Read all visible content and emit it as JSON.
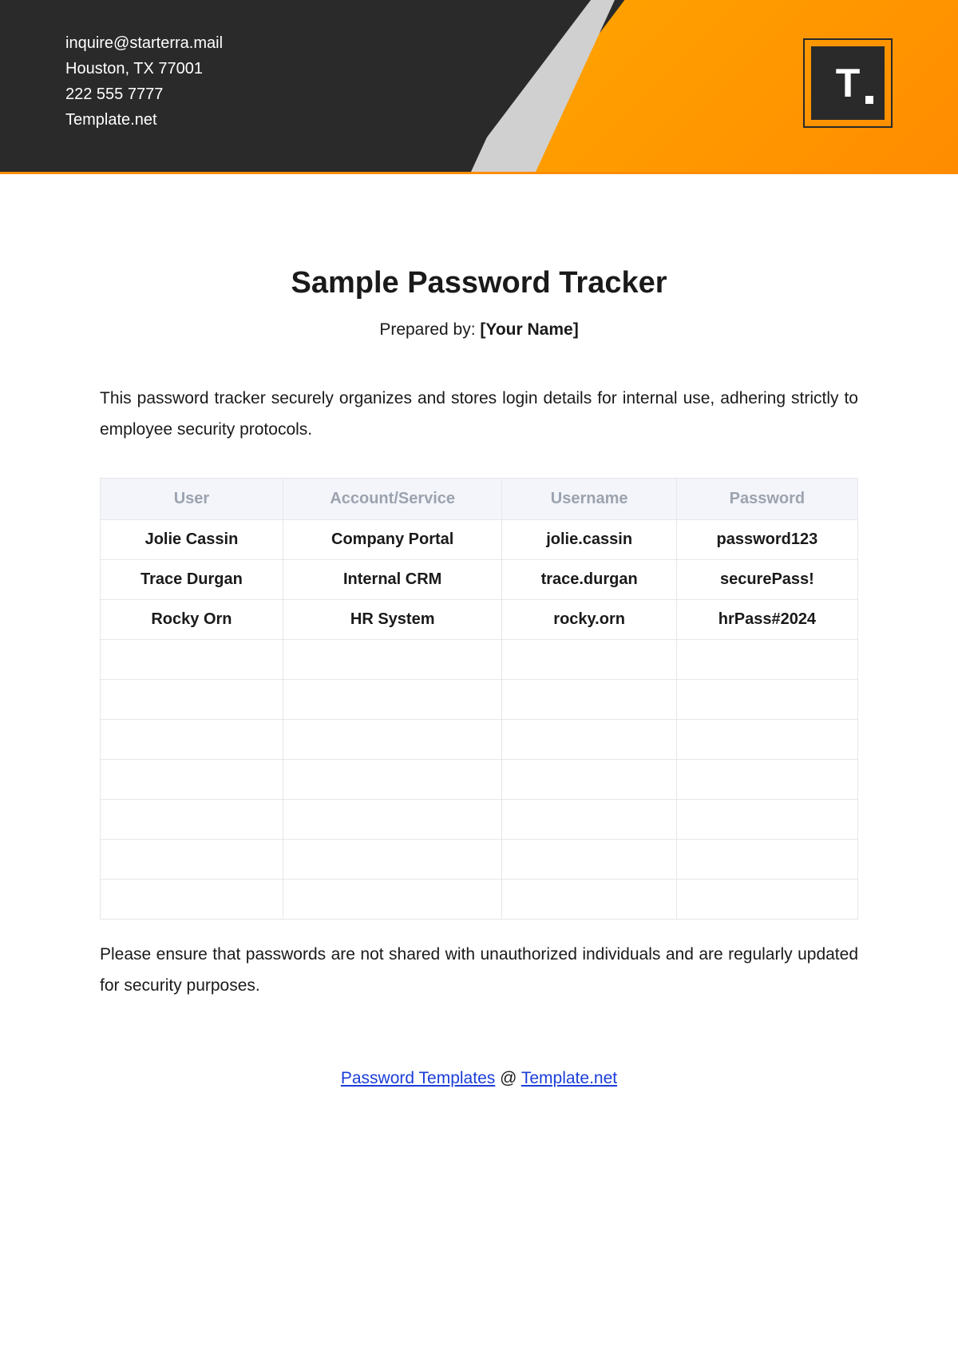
{
  "header": {
    "contact": {
      "email": "inquire@starterra.mail",
      "address": "Houston, TX 77001",
      "phone": "222 555 7777",
      "website": "Template.net"
    },
    "logo_text": "T"
  },
  "main": {
    "title": "Sample Password Tracker",
    "prepared_by_label": "Prepared by: ",
    "prepared_by_value": "[Your Name]",
    "description": "This password tracker securely organizes and stores login details for internal use, adhering strictly to employee security protocols.",
    "table": {
      "headers": [
        "User",
        "Account/Service",
        "Username",
        "Password"
      ],
      "rows": [
        [
          "Jolie Cassin",
          "Company Portal",
          "jolie.cassin",
          "password123"
        ],
        [
          "Trace Durgan",
          "Internal CRM",
          "trace.durgan",
          "securePass!"
        ],
        [
          "Rocky Orn",
          "HR System",
          "rocky.orn",
          "hrPass#2024"
        ]
      ],
      "empty_rows": 7
    },
    "footer_note": "Please ensure that passwords are not shared with unauthorized individuals and are regularly updated for security purposes.",
    "footer_links": {
      "link1_text": "Password Templates",
      "separator": " @ ",
      "link2_text": "Template.net"
    }
  }
}
